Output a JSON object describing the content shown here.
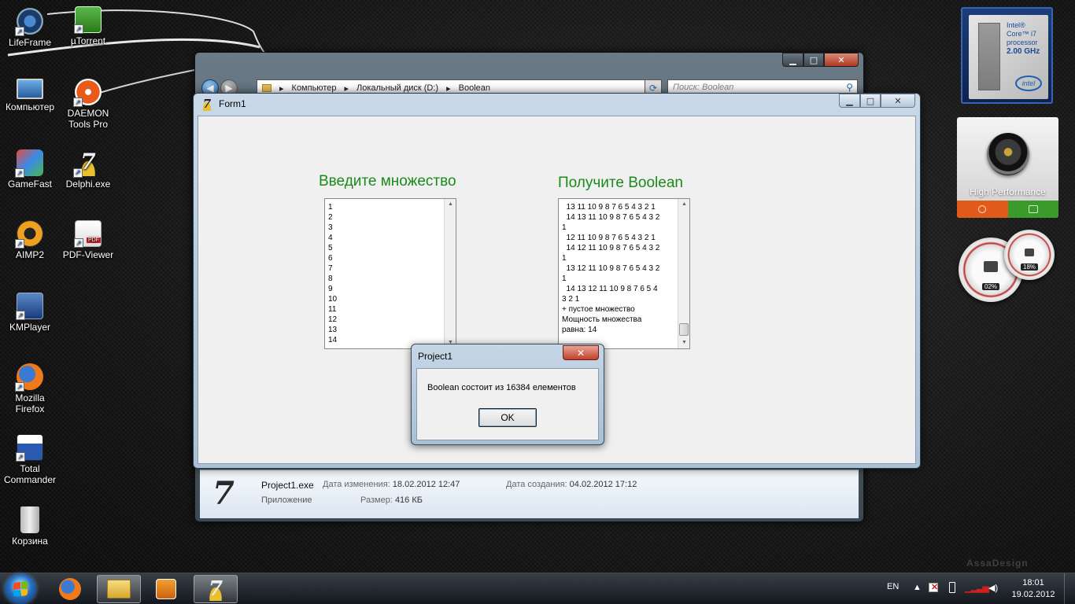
{
  "desktop": {
    "icons": [
      {
        "label": "LifeFrame",
        "icon": "webcam-icon"
      },
      {
        "label": "µTorrent",
        "icon": "utorrent-icon"
      },
      {
        "label": "Компьютер",
        "icon": "computer-icon"
      },
      {
        "label": "DAEMON Tools Pro",
        "icon": "daemon-tools-icon"
      },
      {
        "label": "GameFast",
        "icon": "gamefast-icon"
      },
      {
        "label": "Delphi.exe",
        "icon": "delphi-icon"
      },
      {
        "label": "AIMP2",
        "icon": "aimp-icon"
      },
      {
        "label": "PDF-Viewer",
        "icon": "pdf-icon"
      },
      {
        "label": "KMPlayer",
        "icon": "kmplayer-icon"
      },
      {
        "label": "Mozilla Firefox",
        "icon": "firefox-icon"
      },
      {
        "label": "Total Commander",
        "icon": "total-commander-icon"
      },
      {
        "label": "Корзина",
        "icon": "recycle-bin-icon"
      }
    ]
  },
  "gadgets": {
    "cpu": {
      "brand": "Intel®",
      "line": "Core™ i7",
      "word": "processor",
      "speed": "2.00 GHz",
      "logo": "intel"
    },
    "power": {
      "label": "High Performance"
    },
    "meter": {
      "cpu_value": "02%",
      "ram_value": "18%"
    }
  },
  "explorer": {
    "breadcrumb": [
      "Компьютер",
      "Локальный диск (D:)",
      "Boolean"
    ],
    "search_placeholder": "Поиск: Boolean",
    "details": {
      "file_name": "Project1.exe",
      "file_type": "Приложение",
      "modified_label": "Дата изменения:",
      "modified_value": "18.02.2012 12:47",
      "size_label": "Размер:",
      "size_value": "416 КБ",
      "created_label": "Дата создания:",
      "created_value": "04.02.2012 17:12"
    }
  },
  "form1": {
    "title": "Form1",
    "logo_glyph": "7",
    "left_heading": "Введите множество",
    "right_heading": "Получите Boolean",
    "input_lines": [
      "1",
      "2",
      "3",
      "4",
      "5",
      "6",
      "7",
      "8",
      "9",
      "10",
      "11",
      "12",
      "13",
      "14"
    ],
    "output_lines": [
      "  13 11 10 9 8 7 6 5 4 3 2 1",
      "  14 13 11 10 9 8 7 6 5 4 3 2",
      "1",
      "  12 11 10 9 8 7 6 5 4 3 2 1",
      "  14 12 11 10 9 8 7 6 5 4 3 2",
      "1",
      "  13 12 11 10 9 8 7 6 5 4 3 2",
      "1",
      "  14 13 12 11 10 9 8 7 6 5 4",
      "3 2 1",
      "+ пустое множество",
      "Мощность множества",
      "равна: 14"
    ]
  },
  "msgbox": {
    "title": "Project1",
    "close_glyph": "✕",
    "message": "Boolean состоит из 16384 елементов",
    "ok_label": "OK"
  },
  "window_buttons": {
    "minimize": "▁",
    "maximize": "□",
    "close": "✕"
  },
  "watermark": "AssaDesign",
  "taskbar": {
    "language": "EN",
    "time": "18:01",
    "date": "19.02.2012"
  },
  "colors": {
    "heading_green": "#1a8a1a",
    "accent_blue": "#2a6ab0"
  }
}
